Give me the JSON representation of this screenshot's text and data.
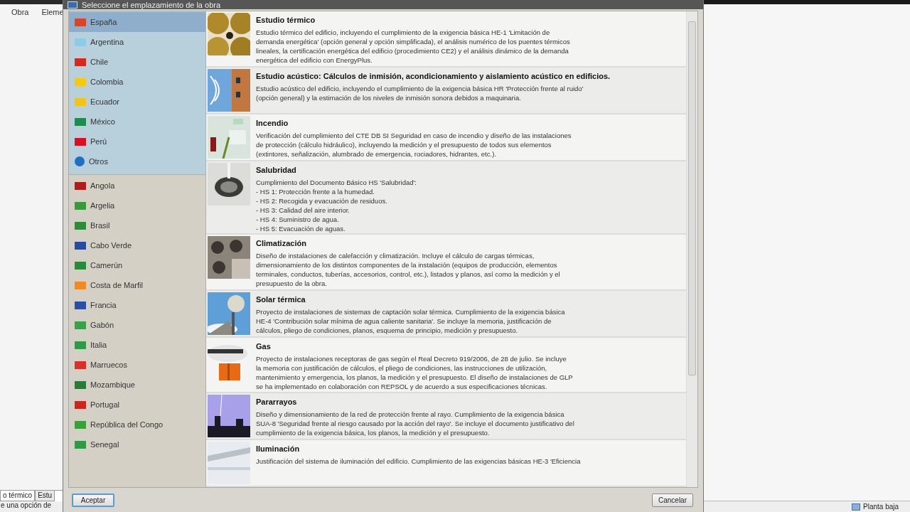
{
  "background_app": {
    "menu": [
      "Obra",
      "Eleme"
    ],
    "tabs": [
      {
        "label": "o térmico",
        "selected": true
      },
      {
        "label": "Estu",
        "selected": false
      }
    ],
    "status_text": "e una opción de",
    "status_right": "Planta baja"
  },
  "window": {
    "title": "Seleccione el emplazamiento de la obra"
  },
  "sidebar": {
    "groups": [
      {
        "items": [
          {
            "label": "España",
            "selected": true,
            "kind": "flag",
            "color": "#d9452b"
          },
          {
            "label": "Argentina",
            "selected": false,
            "kind": "flag",
            "color": "#8ecbe8"
          },
          {
            "label": "Chile",
            "selected": false,
            "kind": "flag",
            "color": "#d52b1e"
          },
          {
            "label": "Colombia",
            "selected": false,
            "kind": "flag",
            "color": "#f4c90f"
          },
          {
            "label": "Ecuador",
            "selected": false,
            "kind": "flag",
            "color": "#f0c419"
          },
          {
            "label": "México",
            "selected": false,
            "kind": "flag",
            "color": "#1e8c4e"
          },
          {
            "label": "Perú",
            "selected": false,
            "kind": "flag",
            "color": "#d91023"
          },
          {
            "label": "Otros",
            "selected": false,
            "kind": "globe",
            "color": "#1f6fc4"
          }
        ]
      },
      {
        "items": [
          {
            "label": "Angola",
            "selected": false,
            "kind": "flag",
            "color": "#b01c1c"
          },
          {
            "label": "Argelia",
            "selected": false,
            "kind": "flag",
            "color": "#3a9a3a"
          },
          {
            "label": "Brasil",
            "selected": false,
            "kind": "flag",
            "color": "#2e8b3a"
          },
          {
            "label": "Cabo Verde",
            "selected": false,
            "kind": "flag",
            "color": "#2a4aa0"
          },
          {
            "label": "Camerún",
            "selected": false,
            "kind": "flag",
            "color": "#2a8a3a"
          },
          {
            "label": "Costa de Marfil",
            "selected": false,
            "kind": "flag",
            "color": "#f08a24"
          },
          {
            "label": "Francia",
            "selected": false,
            "kind": "flag",
            "color": "#2c4fa3"
          },
          {
            "label": "Gabón",
            "selected": false,
            "kind": "flag",
            "color": "#3aa04a"
          },
          {
            "label": "Italia",
            "selected": false,
            "kind": "flag",
            "color": "#2e9a45"
          },
          {
            "label": "Marruecos",
            "selected": false,
            "kind": "flag",
            "color": "#d8312a"
          },
          {
            "label": "Mozambique",
            "selected": false,
            "kind": "flag",
            "color": "#2a7a3a"
          },
          {
            "label": "Portugal",
            "selected": false,
            "kind": "flag",
            "color": "#c8281e"
          },
          {
            "label": "República del Congo",
            "selected": false,
            "kind": "flag",
            "color": "#3aa03a"
          },
          {
            "label": "Senegal",
            "selected": false,
            "kind": "flag",
            "color": "#2e9a45"
          }
        ]
      }
    ]
  },
  "modules": [
    {
      "title": "Estudio térmico",
      "description": "Estudio térmico del edificio, incluyendo el cumplimiento de la exigencia básica HE-1 'Limitación de\ndemanda energética' (opción general y opción simplificada), el análisis numérico de los puentes térmicos\nlineales, la certificación energética del edificio (procedimiento CE2) y el análisis dinámico de la demanda\nenergética del edificio con EnergyPlus."
    },
    {
      "title": "Estudio acústico: Cálculos de inmisión, acondicionamiento y aislamiento acústico en edificios.",
      "description": "Estudio acústico del edificio, incluyendo el cumplimiento de la exigencia básica HR 'Protección frente al ruido'\n(opción general) y la estimación de los niveles de inmisión sonora debidos a maquinaria."
    },
    {
      "title": "Incendio",
      "description": "Verificación del cumplimiento del CTE DB SI Seguridad en caso de incendio y diseño de las instalaciones\nde protección (cálculo hidráulico), incluyendo la medición y el presupuesto de todos sus elementos\n(extintores, señalización, alumbrado de emergencia, rociadores, hidrantes, etc.)."
    },
    {
      "title": "Salubridad",
      "description": "Cumplimiento del Documento Básico HS 'Salubridad':\n- HS 1: Protección frente a la humedad.\n- HS 2: Recogida y evacuación de residuos.\n- HS 3: Calidad del aire interior.\n- HS 4: Suministro de agua.\n- HS 5: Evacuación de aguas."
    },
    {
      "title": "Climatización",
      "description": "Diseño de instalaciones de calefacción y climatización. Incluye el cálculo de cargas térmicas,\ndimensionamiento de los distintos componentes de la instalación (equipos de producción, elementos\nterminales, conductos, tuberías, accesorios, control, etc.), listados y planos, así como la medición y el\npresupuesto de la obra."
    },
    {
      "title": "Solar térmica",
      "description": "Proyecto de instalaciones de sistemas de captación solar térmica. Cumplimiento de la exigencia básica\nHE-4 'Contribución solar mínima de agua caliente sanitaria'. Se incluye la memoria, justificación de\ncálculos, pliego de condiciones, planos, esquema de principio, medición y presupuesto."
    },
    {
      "title": "Gas",
      "description": "Proyecto de instalaciones receptoras de gas según el Real Decreto 919/2006, de 28 de julio. Se incluye\nla memoria con justificación de cálculos, el pliego de condiciones, las instrucciones de utilización,\nmantenimiento y emergencia, los planos, la medición y el presupuesto. El diseño de instalaciones de GLP\nse ha implementado en colaboración con REPSOL y de acuerdo a sus especificaciones técnicas."
    },
    {
      "title": "Pararrayos",
      "description": "Diseño y dimensionamiento de la red de protección frente al rayo. Cumplimiento de la exigencia básica\nSUA-8 'Seguridad frente al riesgo causado por la acción del rayo'. Se incluye el documento justificativo del\ncumplimiento de la exigencia básica, los planos, la medición y el presupuesto."
    },
    {
      "title": "Iluminación",
      "description": "Justificación del sistema de iluminación del edificio. Cumplimiento de las exigencias básicas HE-3 'Eficiencia"
    }
  ],
  "buttons": [
    {
      "label": "Aceptar",
      "kind": "default"
    },
    {
      "label": "Cancelar",
      "kind": "normal"
    }
  ]
}
